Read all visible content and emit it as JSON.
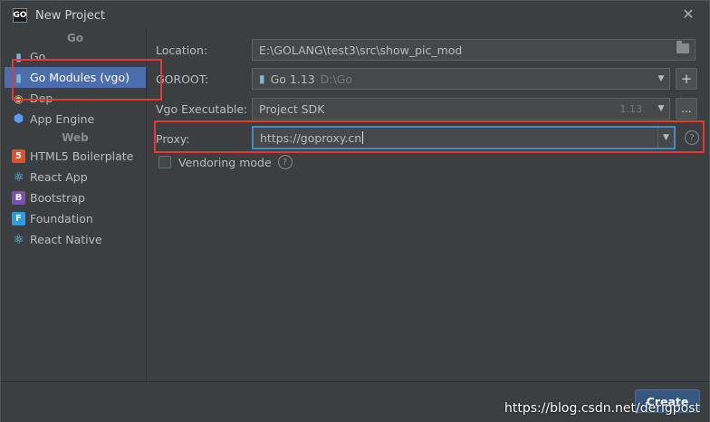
{
  "window": {
    "app_logo": "GO",
    "title": "New Project"
  },
  "sidebar": {
    "groups": [
      {
        "heading": "Go",
        "items": [
          {
            "label": "Go",
            "icon": "gopher-icon"
          },
          {
            "label": "Go Modules (vgo)",
            "icon": "gopher-icon",
            "selected": true
          },
          {
            "label": "Dep",
            "icon": "dep-icon"
          },
          {
            "label": "App Engine",
            "icon": "app-engine-icon"
          }
        ]
      },
      {
        "heading": "Web",
        "items": [
          {
            "label": "HTML5 Boilerplate",
            "icon": "html5-icon",
            "icon_text": "5"
          },
          {
            "label": "React App",
            "icon": "react-icon"
          },
          {
            "label": "Bootstrap",
            "icon": "bootstrap-icon",
            "icon_text": "B"
          },
          {
            "label": "Foundation",
            "icon": "foundation-icon",
            "icon_text": "F"
          },
          {
            "label": "React Native",
            "icon": "react-icon"
          }
        ]
      }
    ]
  },
  "form": {
    "location": {
      "label": "Location:",
      "value": "E:\\GOLANG\\test3\\src\\show_pic_mod"
    },
    "goroot": {
      "label": "GOROOT:",
      "value": "Go 1.13",
      "path": "D:\\Go"
    },
    "vgo": {
      "label": "Vgo Executable:",
      "value": "Project SDK",
      "version": "1.13",
      "browse": "..."
    },
    "proxy": {
      "label": "Proxy:",
      "value": "https://goproxy.cn"
    },
    "vendoring": {
      "label": "Vendoring mode",
      "checked": false
    }
  },
  "footer": {
    "create_label": "Create",
    "watermark": "https://blog.csdn.net/derigpost"
  },
  "colors": {
    "accent_selected": "#4b6eaf",
    "annotation_red": "#e53935",
    "focus_border": "#4a88c7"
  }
}
